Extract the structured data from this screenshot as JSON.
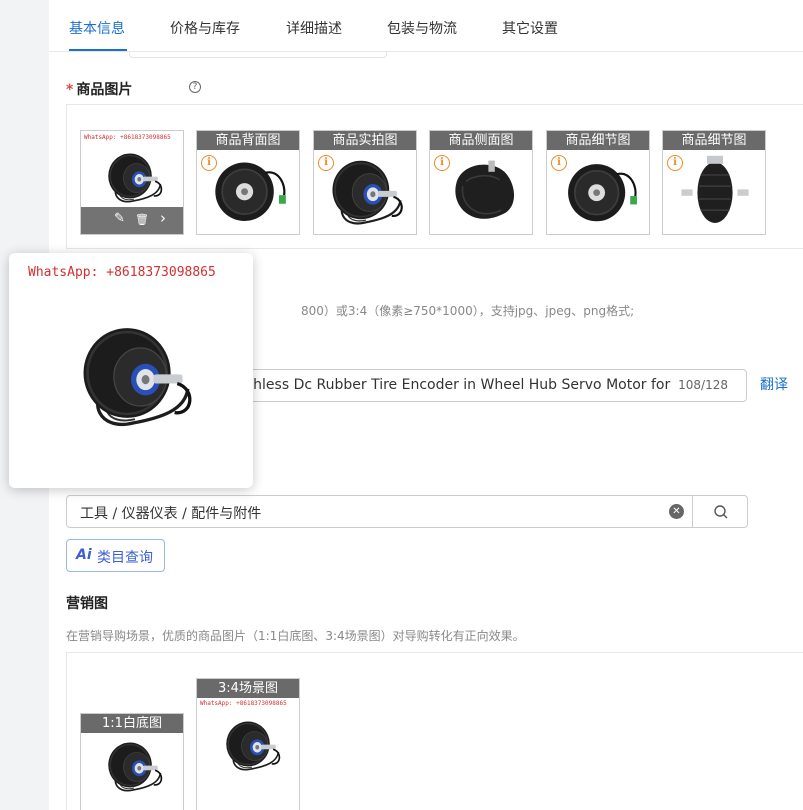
{
  "tabs": [
    "基本信息",
    "价格与库存",
    "详细描述",
    "包装与物流",
    "其它设置"
  ],
  "images_section": {
    "required_mark": "*",
    "title": "商品图片",
    "help": "?",
    "thumbs": [
      "商品背面图",
      "商品实拍图",
      "商品侧面图",
      "商品细节图",
      "商品细节图"
    ],
    "info_glyph": "i",
    "watermark": "WhatsApp: +8618373098865",
    "tools": {
      "edit": "✎",
      "delete": "🗑",
      "next": "›"
    }
  },
  "image_requirement_text": "800）或3:4（像素≥750*1000），支持jpg、jpeg、png格式;",
  "title_field": {
    "value": "ushless Dc Rubber Tire Encoder in Wheel Hub Servo Motor for Ag",
    "counter": "108/128",
    "translate": "翻译"
  },
  "category_field": {
    "value": "工具 / 仪器仪表 / 配件与附件",
    "clear": "✕"
  },
  "ai_button": {
    "ai": "Ai",
    "label": "类目查询"
  },
  "marketing": {
    "title": "营销图",
    "description": "在营销导购场景，优质的商品图片（1:1白底图、3:4场景图）对导购转化有正向效果。",
    "thumbs": [
      "1:1白底图",
      "3:4场景图"
    ]
  },
  "popup": {
    "watermark": "WhatsApp: +8618373098865"
  },
  "colors": {
    "accent": "#1a6fd1",
    "required": "#e54545",
    "warning": "#f08a24",
    "watermark": "#d23030"
  }
}
